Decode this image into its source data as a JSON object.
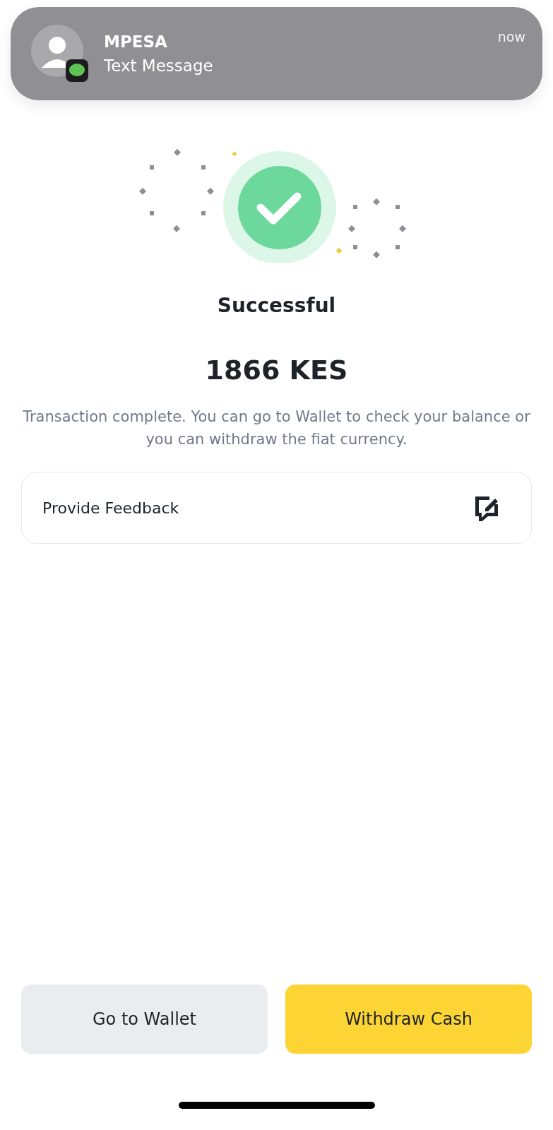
{
  "notification": {
    "sender": "MPESA",
    "subtitle": "Text Message",
    "time": "now"
  },
  "result": {
    "title": "Successful",
    "amount": "1866 KES",
    "message": "Transaction complete. You can go to Wallet to check your balance or you can withdraw the fiat currency."
  },
  "feedback": {
    "label": "Provide Feedback"
  },
  "buttons": [
    {
      "label": "Go to Wallet",
      "kind": "secondary"
    },
    {
      "label": "Withdraw Cash",
      "kind": "primary"
    }
  ]
}
